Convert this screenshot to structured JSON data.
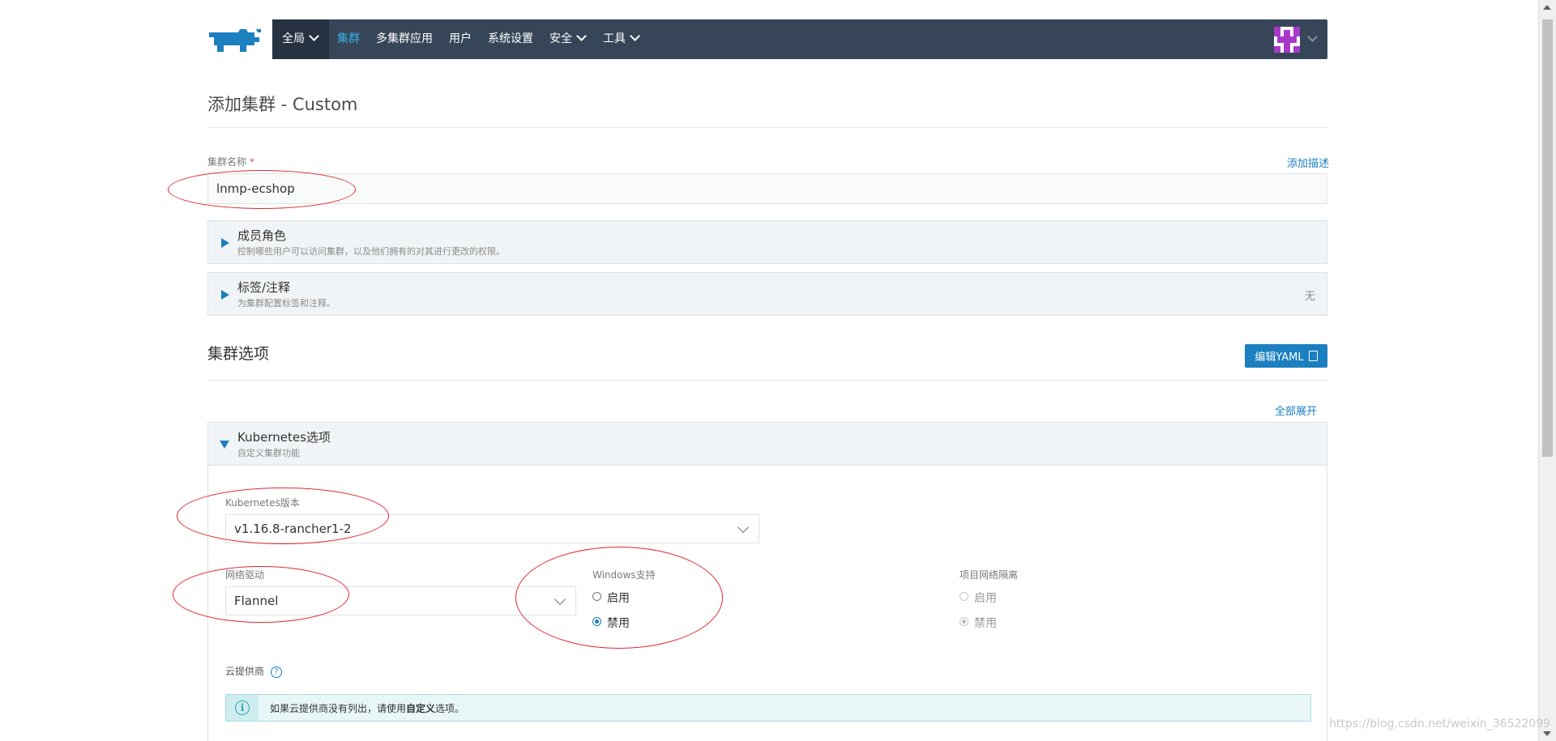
{
  "header": {
    "nav": [
      "全局",
      "集群",
      "多集群应用",
      "用户",
      "系统设置",
      "安全",
      "工具"
    ]
  },
  "page": {
    "title": "添加集群 - Custom"
  },
  "cluster_name": {
    "label": "集群名称",
    "required_mark": "*",
    "value": "lnmp-ecshop",
    "add_description_link": "添加描述"
  },
  "panels": {
    "members": {
      "title": "成员角色",
      "subtitle": "控制哪些用户可以访问集群，以及他们拥有的对其进行更改的权限。"
    },
    "labels": {
      "title": "标签/注释",
      "subtitle": "为集群配置标签和注释。",
      "right_value": "无"
    }
  },
  "cluster_options": {
    "title": "集群选项",
    "edit_yaml_button": "编辑YAML",
    "expand_all_link": "全部展开"
  },
  "k8s_options": {
    "title": "Kubernetes选项",
    "subtitle": "自定义集群功能",
    "version_label": "Kubernetes版本",
    "version_value": "v1.16.8-rancher1-2",
    "network_label": "网络驱动",
    "network_value": "Flannel",
    "windows_label": "Windows支持",
    "windows_enable": "启用",
    "windows_disable": "禁用",
    "isolation_label": "项目网络隔离",
    "isolation_enable": "启用",
    "isolation_disable": "禁用",
    "cloud_label": "云提供商",
    "help_icon": "?",
    "info_text_prefix": "如果云提供商没有列出，请使用",
    "info_text_bold": "自定义",
    "info_text_suffix": "选项。",
    "info_icon": "i"
  },
  "colors": {
    "nav_bg": "#364658",
    "accent": "#1c7fc0",
    "annotation": "#e3262d"
  },
  "watermark": "https://blog.csdn.net/weixin_36522099"
}
